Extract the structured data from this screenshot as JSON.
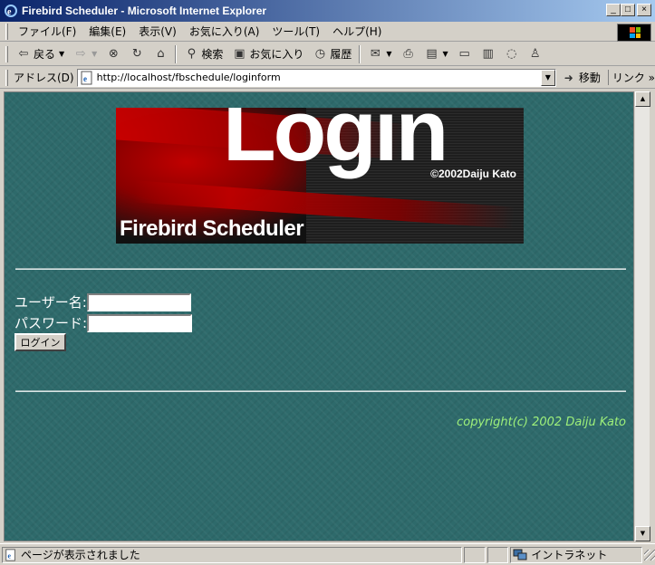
{
  "window": {
    "title": "Firebird Scheduler - Microsoft Internet Explorer",
    "buttons": {
      "minimize": "_",
      "maximize": "□",
      "close": "×"
    }
  },
  "menu": {
    "items": [
      "ファイル(F)",
      "編集(E)",
      "表示(V)",
      "お気に入り(A)",
      "ツール(T)",
      "ヘルプ(H)"
    ]
  },
  "toolbar": {
    "back_label": "戻る",
    "search_label": "検索",
    "favorites_label": "お気に入り",
    "history_label": "履歴"
  },
  "address": {
    "label": "アドレス(D)",
    "url": "http://localhost/fbschedule/loginform",
    "go_label": "移動",
    "links_label": "リンク »"
  },
  "page": {
    "banner": {
      "heading": "Login",
      "copyright": "©2002Daiju Kato",
      "app_name": "Firebird Scheduler"
    },
    "form": {
      "username_label": "ユーザー名:",
      "username_value": "",
      "password_label": "パスワード:",
      "password_value": "",
      "submit_label": "ログイン"
    },
    "footer": "copyright(c) 2002 Daiju Kato",
    "colors": {
      "background": "#2e6a6b",
      "footer_text": "#9ef07a",
      "label_text": "#ffffff"
    }
  },
  "status": {
    "message": "ページが表示されました",
    "zone": "イントラネット"
  }
}
